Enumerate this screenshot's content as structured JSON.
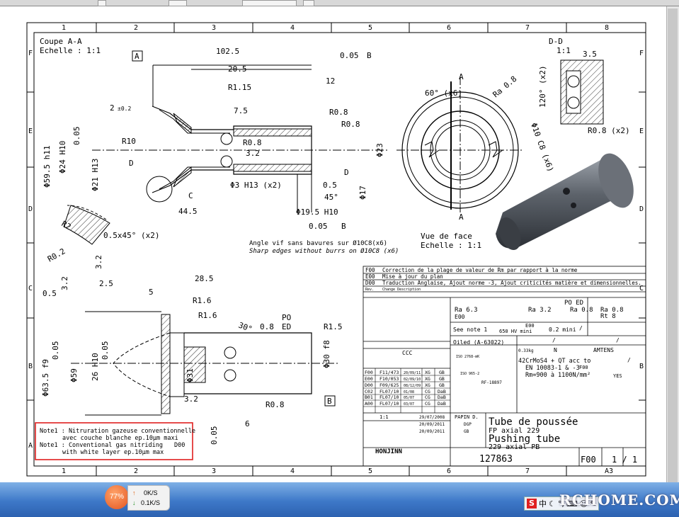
{
  "grid": {
    "columns": [
      "1",
      "2",
      "3",
      "4",
      "5",
      "6",
      "7",
      "8"
    ],
    "rows": [
      "F",
      "E",
      "D",
      "C",
      "B",
      "A"
    ]
  },
  "views": {
    "section_aa_title": "Coupe A-A",
    "section_aa_scale": "Echelle :  1:1",
    "section_dd_title": "D-D",
    "section_dd_scale": "1:1",
    "front_view_title": "Vue de face",
    "front_view_scale": "Echelle :  1:1"
  },
  "dims": {
    "d102": "102.5",
    "d20": "20.5",
    "r115": "R1.15",
    "d75": "7.5",
    "d12": "12",
    "r08a": "R0.8",
    "r08b": "R0.8",
    "r08c": "R0.8",
    "d2": "2",
    "d2tol": "±0.2",
    "r10": "R10",
    "d32a": "3.2",
    "d23": "Φ23",
    "d05": "0.5",
    "d45deg": "45°",
    "d17": "Φ17",
    "d3h13": "Φ3 H13 (x2)",
    "d445": "44.5",
    "d195": "Φ19.5 H10",
    "d21h13": "Φ21 H13",
    "d595": "Φ59.5 h11",
    "d24h10": "Φ24 H10",
    "tol005": "0.05",
    "datum_a": "A",
    "datum_b": "B",
    "datum_c": "C",
    "datum_d": "D",
    "chamfer": "0.5x45° (x2)",
    "r2": "R2",
    "r02": "R0.2",
    "d32b": "3.2",
    "d32c": "3.2",
    "d25": "2.5",
    "d05b": "0.5",
    "d285": "28.5",
    "d5": "5",
    "r16a": "R1.6",
    "r16b": "R1.6",
    "d08": "0.8",
    "r15": "R1.5",
    "d30": "30°",
    "po": "PO",
    "ed": "ED",
    "d635": "Φ63.5 f9",
    "d59": "Φ59",
    "d26": "26 H10",
    "d31": "Φ31",
    "d30f8": "Φ30 f8",
    "d32d": "3.2",
    "r08d": "R0.8",
    "d6": "6",
    "d60x6": "60° (x6)",
    "d120": "120° (x2)",
    "ra08rt": "Ra 0.8",
    "d35": "3.5",
    "r08x2": "R0.8 (x2)",
    "d10c8": "Φ10 C8 (x6)",
    "sharp_fr": "Angle vif sans bavures sur Ø10C8(x6)",
    "sharp_en": "Sharp edges without burrs on Ø10C8 (x6)"
  },
  "notes": {
    "line1": "Note1 : Nitruration gazeuse conventionnelle",
    "line2": "avec couche blanche ep.10µm maxi",
    "line3": "Note1 : Conventional gas nitriding",
    "line4": "with white layer ep.10µm max",
    "ref": "D00"
  },
  "revisions": [
    {
      "code": "F00",
      "text": "Correction de la plage de valeur de Rm par rapport à la norme"
    },
    {
      "code": "E00",
      "text": "Mise à jour du plan"
    },
    {
      "code": "D00",
      "text": "Traduction Anglaise, Ajout norme -3, Ajout criticités matière et dimensionnelles."
    },
    {
      "code": "Rev.",
      "text": "Change Description"
    }
  ],
  "title_block": {
    "title_fr": "Tube de poussée",
    "sub_fr": "FP axial 229",
    "title_en": "Pushing tube",
    "sub_en": "229 axial PB",
    "drawing_no": "127863",
    "revision": "F00",
    "sheet": "1 / 1",
    "format": "A3",
    "company": "HONJINN",
    "material1": "42CrMoS4 + QT acc to",
    "material2": "EN 10083-1 & -3",
    "material3": "Rm=900 à 1100N/mm²",
    "treatment": "See note 1",
    "hardness": "650 HV mini",
    "depth": "0.2 mini",
    "coating": "Oiled (A-63022)",
    "weight": "0.33kg",
    "drawn_by": "PAPIN D.",
    "date1": "29/07/2008",
    "date2": "20/09/2011",
    "date3": "20/09/2011",
    "checker": "DGP",
    "approver": "GB",
    "scale": "1:1",
    "general_tol": "ISO 2768-mK",
    "thread_tol": "ISO 965-2",
    "based_on": "RF-18897",
    "ccc": "CCC",
    "pallet": "AMTENS",
    "fuse": "YES",
    "n": "N",
    "ra63": "Ra 6.3",
    "ra32": "Ra 3.2",
    "ra08": "Ra 0.8",
    "ra08b": "Ra 0.8",
    "rt8": "Rt 8",
    "po_ed": "PO ED",
    "e00a": "E00",
    "e00b": "E00",
    "f00": "F00",
    "slash1": "/",
    "slash2": "/",
    "slash3": "/",
    "slash4": "/"
  },
  "revision_table": [
    [
      "F00",
      "F11/473",
      "20/09/11",
      "XG",
      "GB"
    ],
    [
      "E00",
      "F10/053",
      "02/09/10",
      "XG",
      "GB"
    ],
    [
      "D00",
      "F09/625",
      "08/12/09",
      "XG",
      "GB"
    ],
    [
      "C02",
      "FL07/10",
      "01/08",
      "CG",
      "DaB"
    ],
    [
      "B01",
      "FL07/10",
      "05/07",
      "CG",
      "DaB"
    ],
    [
      "A00",
      "FL07/10",
      "03/07",
      "CG",
      "DaB"
    ]
  ],
  "taskbar": {
    "percent": "77%",
    "up": "0K/S",
    "down": "0.1K/S",
    "ime_s": "S",
    "ime_cn": "中",
    "watermark": "RCHOME.COM"
  }
}
